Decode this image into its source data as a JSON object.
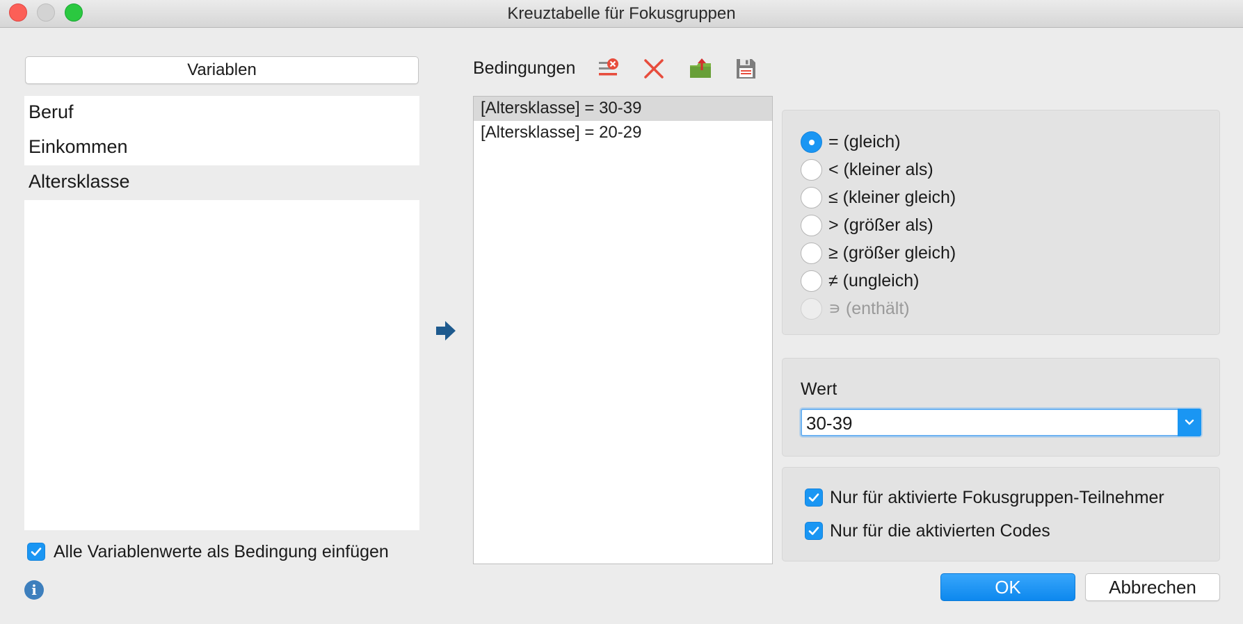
{
  "window": {
    "title": "Kreuztabelle für Fokusgruppen"
  },
  "variables": {
    "header": "Variablen",
    "items": [
      "Beruf",
      "Einkommen",
      "Altersklasse"
    ],
    "insert_all_label": "Alle Variablenwerte als Bedingung einfügen",
    "insert_all_checked": true
  },
  "conditions": {
    "label": "Bedingungen",
    "toolbar_icons": [
      "clear-list-icon",
      "delete-icon",
      "export-icon",
      "save-icon"
    ],
    "items": [
      "[Altersklasse] = 30-39",
      "[Altersklasse] = 20-29"
    ],
    "selected_index": 0
  },
  "operators": {
    "options": [
      {
        "label": "= (gleich)",
        "selected": true,
        "enabled": true
      },
      {
        "label": "< (kleiner als)",
        "selected": false,
        "enabled": true
      },
      {
        "label": "≤ (kleiner gleich)",
        "selected": false,
        "enabled": true
      },
      {
        "label": "> (größer als)",
        "selected": false,
        "enabled": true
      },
      {
        "label": "≥ (größer gleich)",
        "selected": false,
        "enabled": true
      },
      {
        "label": "≠ (ungleich)",
        "selected": false,
        "enabled": true
      },
      {
        "label": "∍ (enthält)",
        "selected": false,
        "enabled": false
      }
    ]
  },
  "value": {
    "label": "Wert",
    "selected": "30-39"
  },
  "options": {
    "only_active_participants": {
      "label": "Nur für aktivierte Fokusgruppen-Teilnehmer",
      "checked": true
    },
    "only_active_codes": {
      "label": "Nur für die aktivierten Codes",
      "checked": true
    }
  },
  "buttons": {
    "ok": "OK",
    "cancel": "Abbrechen"
  },
  "colors": {
    "accent": "#1a96f3",
    "window_bg": "#ececec",
    "delete_red": "#e74c3c",
    "export_green": "#7cb342"
  }
}
